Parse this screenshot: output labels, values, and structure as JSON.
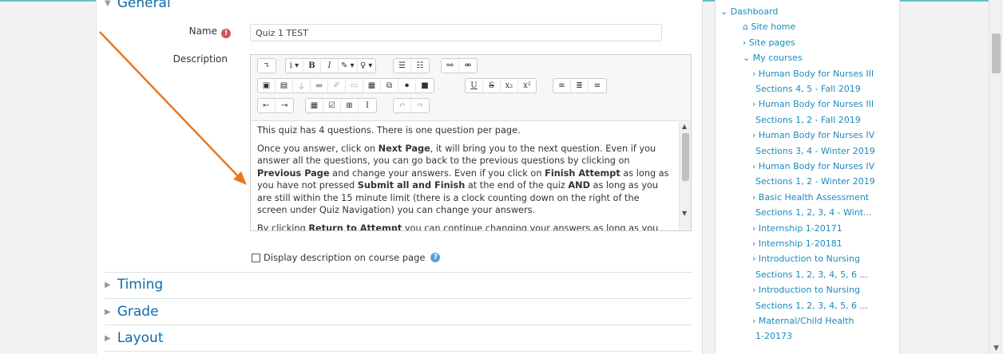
{
  "form": {
    "section_general": "General",
    "name_label": "Name",
    "name_value": "Quiz 1 TEST",
    "description_label": "Description",
    "description_paragraphs": [
      "This quiz has 4 questions. There is one question per page.",
      "Once you answer, click on Next Page, it will bring you to the next question. Even if you answer all the questions, you can go back to the previous questions by clicking on Previous Page and change your answers. Even if you click on Finish Attempt as long as you have not pressed Submit all and Finish at the end of the quiz  AND as long as you are still within the 15 minute limit (there is a clock counting down on the right of the screen under Quiz Navigation) you can change your answers.",
      "By clicking Return to Attempt you can continue changing your answers as long as you"
    ],
    "display_description_label": "Display description on course page",
    "sections": [
      "Timing",
      "Grade",
      "Layout"
    ]
  },
  "editor_toolbar": {
    "row1": [
      [
        "↴"
      ],
      [
        "i ▾",
        "B",
        "I",
        "✎ ▾",
        "♀ ▾"
      ],
      [
        "☰",
        "☷"
      ],
      [
        "⚯",
        "⚮"
      ]
    ],
    "row2": [
      [
        "▣",
        "▤",
        "⏚",
        "▬",
        "✐",
        "▭",
        "▦",
        "⧉",
        "⏺",
        "■"
      ],
      [
        "U",
        "S",
        "x₂",
        "x²"
      ],
      [
        "≡",
        "≣",
        "≡"
      ]
    ],
    "row3": [
      [
        "⇤",
        "⇥"
      ],
      [
        "▦",
        "☑",
        "⊞",
        "I"
      ],
      [
        "↶",
        "↷"
      ]
    ]
  },
  "sidebar": {
    "items": [
      {
        "label": "⌄ Dashboard",
        "indent": 0
      },
      {
        "label": "⌂ Site home",
        "indent": 1
      },
      {
        "label": "› Site pages",
        "indent": 1
      },
      {
        "label": "⌄ My courses",
        "indent": 1
      },
      {
        "label": "› Human Body for Nurses III",
        "indent": 2
      },
      {
        "label": "Sections 4, 5 - Fall 2019",
        "indent": 3
      },
      {
        "label": "› Human Body for Nurses III",
        "indent": 2
      },
      {
        "label": "Sections 1, 2 - Fall 2019",
        "indent": 3
      },
      {
        "label": "› Human Body for Nurses IV",
        "indent": 2
      },
      {
        "label": "Sections 3, 4 - Winter 2019",
        "indent": 3
      },
      {
        "label": "› Human Body for Nurses IV",
        "indent": 2
      },
      {
        "label": "Sections 1, 2 - Winter 2019",
        "indent": 3
      },
      {
        "label": "› Basic Health Assessment",
        "indent": 2
      },
      {
        "label": "Sections 1, 2, 3, 4 - Wint...",
        "indent": 3
      },
      {
        "label": "› Internship 1-20171",
        "indent": 2
      },
      {
        "label": "› Internship 1-20181",
        "indent": 2
      },
      {
        "label": "› Introduction to Nursing",
        "indent": 2
      },
      {
        "label": "Sections 1, 2, 3, 4, 5, 6 ...",
        "indent": 3
      },
      {
        "label": "› Introduction to Nursing",
        "indent": 2
      },
      {
        "label": "Sections 1, 2, 3, 4, 5, 6 ...",
        "indent": 3
      },
      {
        "label": "› Maternal/Child Health",
        "indent": 2
      },
      {
        "label": "1-20173",
        "indent": 3
      }
    ]
  },
  "colors": {
    "accent": "#0a6dab",
    "link": "#1a8bbf",
    "arrow": "#e87722",
    "required": "#d9534f"
  }
}
